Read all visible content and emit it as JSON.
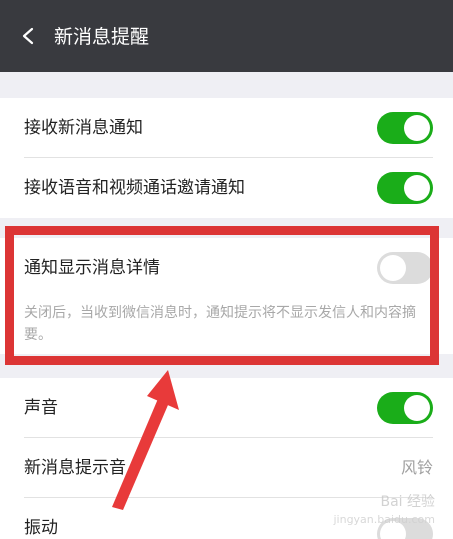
{
  "header": {
    "title": "新消息提醒",
    "back_icon": "chevron-left-icon"
  },
  "settings": {
    "receive_new_message": {
      "label": "接收新消息通知",
      "enabled": true
    },
    "receive_voice_video": {
      "label": "接收语音和视频通话邀请通知",
      "enabled": true
    },
    "show_details": {
      "label": "通知显示消息详情",
      "enabled": false
    },
    "show_details_desc": "关闭后，当收到微信消息时，通知提示将不显示发信人和内容摘要。",
    "sound": {
      "label": "声音",
      "enabled": true
    },
    "ringtone": {
      "label": "新消息提示音",
      "value": "风铃"
    },
    "vibrate": {
      "label": "振动",
      "enabled": false
    }
  },
  "annotation": {
    "box_color": "#dc3535",
    "arrow_color": "#e83a3a"
  },
  "watermark": {
    "text": "Bai 经验",
    "sub": "jingyan.baidu.com"
  },
  "colors": {
    "header_bg": "#393a3f",
    "toggle_on": "#1aad19",
    "toggle_off": "#dcdcdc",
    "page_bg": "#efeff4"
  }
}
